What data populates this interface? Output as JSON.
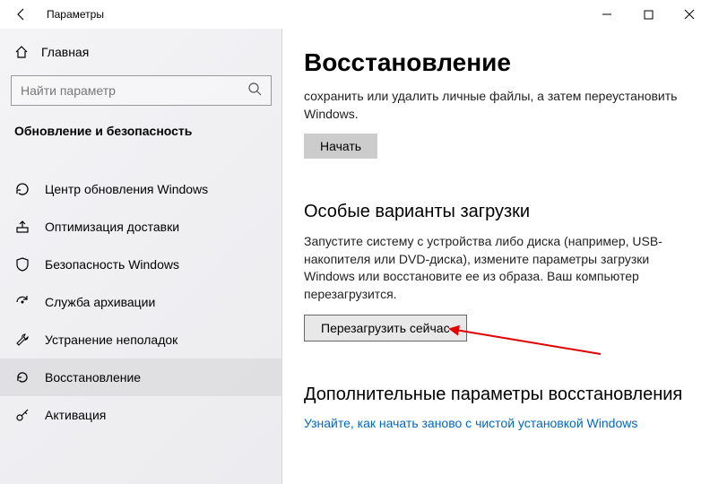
{
  "window": {
    "title": "Параметры"
  },
  "sidebar": {
    "home_label": "Главная",
    "search_placeholder": "Найти параметр",
    "category": "Обновление и безопасность",
    "items": [
      {
        "label": "Центр обновления Windows"
      },
      {
        "label": "Оптимизация доставки"
      },
      {
        "label": "Безопасность Windows"
      },
      {
        "label": "Служба архивации"
      },
      {
        "label": "Устранение неполадок"
      },
      {
        "label": "Восстановление"
      },
      {
        "label": "Активация"
      }
    ]
  },
  "content": {
    "heading": "Восстановление",
    "reset_desc": "сохранить или удалить личные файлы, а затем переустановить Windows.",
    "reset_button": "Начать",
    "advanced_heading": "Особые варианты загрузки",
    "advanced_desc": "Запустите систему с устройства либо диска (например, USB-накопителя или DVD-диска), измените параметры загрузки Windows или восстановите ее из образа. Ваш компьютер перезагрузится.",
    "advanced_button": "Перезагрузить сейчас",
    "more_heading": "Дополнительные параметры восстановления",
    "more_link": "Узнайте, как начать заново с чистой установкой Windows"
  }
}
